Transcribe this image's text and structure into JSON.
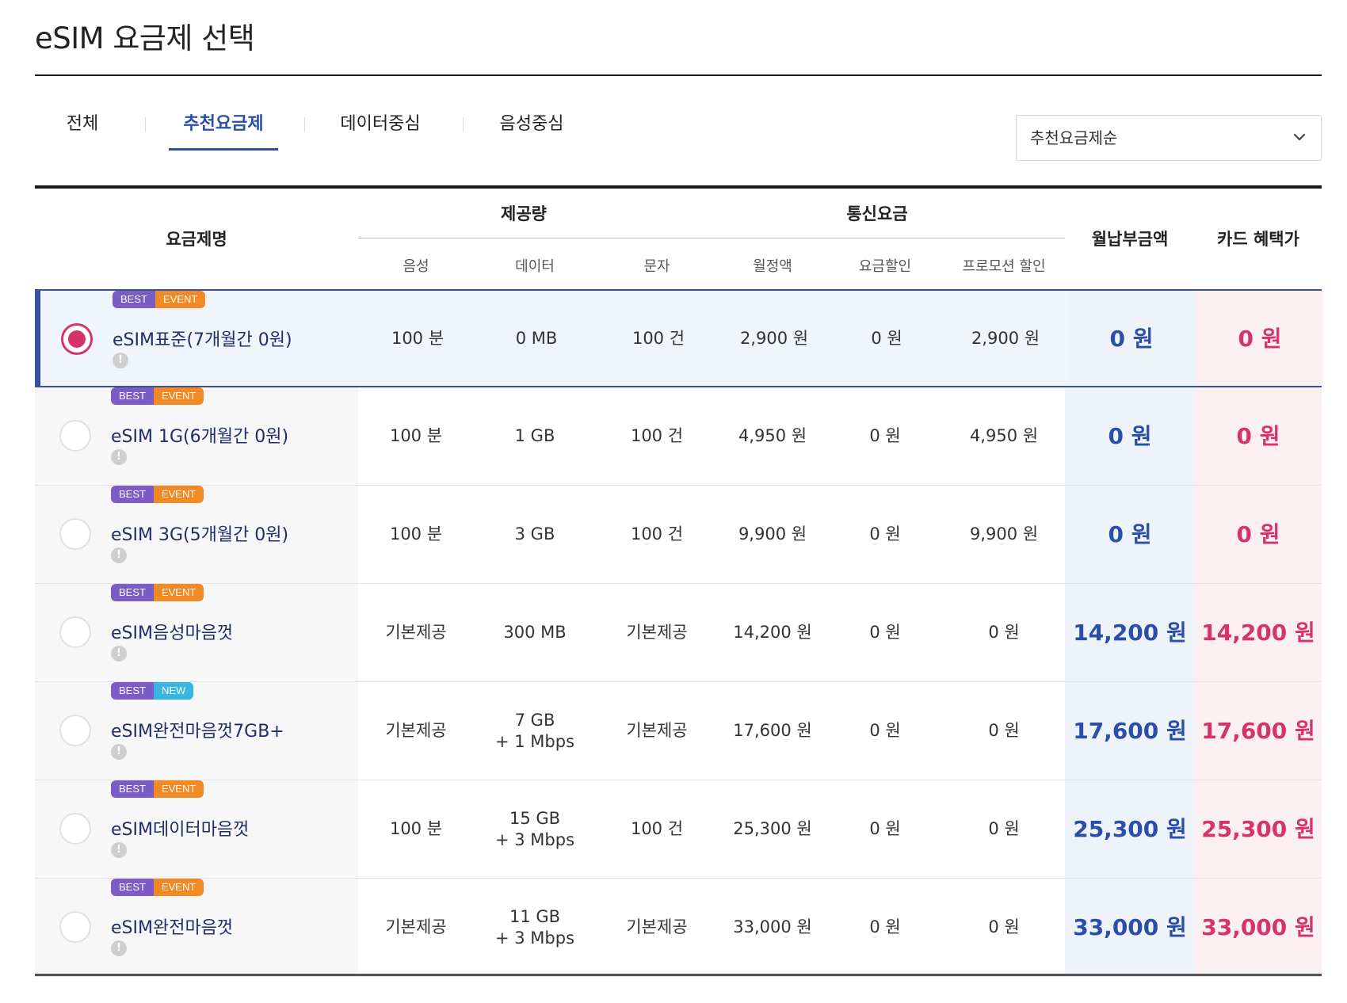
{
  "page": {
    "title": "eSIM 요금제 선택"
  },
  "tabs": [
    {
      "label": "전체",
      "active": false
    },
    {
      "label": "추천요금제",
      "active": true
    },
    {
      "label": "데이터중심",
      "active": false
    },
    {
      "label": "음성중심",
      "active": false
    }
  ],
  "sort": {
    "selected": "추천요금제순"
  },
  "table": {
    "headers": {
      "plan_name": "요금제명",
      "provided": "제공량",
      "fee": "통신요금",
      "monthly_pay": "월납부금액",
      "card_benefit": "카드 혜택가",
      "voice": "음성",
      "data": "데이터",
      "sms": "문자",
      "monthly_fee": "월정액",
      "fee_discount": "요금할인",
      "promo_discount": "프로모션 할인"
    },
    "rows": [
      {
        "badge1": "BEST",
        "badge2": "EVENT",
        "badge2_type": "event",
        "name": "eSIM표준(7개월간 0원)",
        "voice": "100 분",
        "data": "0 MB",
        "data_speed": "",
        "sms": "100 건",
        "monthly_fee": "2,900 원",
        "fee_discount": "0 원",
        "promo_discount": "2,900 원",
        "monthly_pay": "0 원",
        "card_benefit": "0 원",
        "selected": true
      },
      {
        "badge1": "BEST",
        "badge2": "EVENT",
        "badge2_type": "event",
        "name": "eSIM 1G(6개월간 0원)",
        "voice": "100 분",
        "data": "1 GB",
        "data_speed": "",
        "sms": "100 건",
        "monthly_fee": "4,950 원",
        "fee_discount": "0 원",
        "promo_discount": "4,950 원",
        "monthly_pay": "0 원",
        "card_benefit": "0 원",
        "selected": false
      },
      {
        "badge1": "BEST",
        "badge2": "EVENT",
        "badge2_type": "event",
        "name": "eSIM 3G(5개월간 0원)",
        "voice": "100 분",
        "data": "3 GB",
        "data_speed": "",
        "sms": "100 건",
        "monthly_fee": "9,900 원",
        "fee_discount": "0 원",
        "promo_discount": "9,900 원",
        "monthly_pay": "0 원",
        "card_benefit": "0 원",
        "selected": false
      },
      {
        "badge1": "BEST",
        "badge2": "EVENT",
        "badge2_type": "event",
        "name": "eSIM음성마음껏",
        "voice": "기본제공",
        "data": "300 MB",
        "data_speed": "",
        "sms": "기본제공",
        "monthly_fee": "14,200 원",
        "fee_discount": "0 원",
        "promo_discount": "0 원",
        "monthly_pay": "14,200 원",
        "card_benefit": "14,200 원",
        "selected": false
      },
      {
        "badge1": "BEST",
        "badge2": "NEW",
        "badge2_type": "new",
        "name": "eSIM완전마음껏7GB+",
        "voice": "기본제공",
        "data": "7 GB",
        "data_speed": "+ 1 Mbps",
        "sms": "기본제공",
        "monthly_fee": "17,600 원",
        "fee_discount": "0 원",
        "promo_discount": "0 원",
        "monthly_pay": "17,600 원",
        "card_benefit": "17,600 원",
        "selected": false
      },
      {
        "badge1": "BEST",
        "badge2": "EVENT",
        "badge2_type": "event",
        "name": "eSIM데이터마음껏",
        "voice": "100 분",
        "data": "15 GB",
        "data_speed": "+ 3 Mbps",
        "sms": "100 건",
        "monthly_fee": "25,300 원",
        "fee_discount": "0 원",
        "promo_discount": "0 원",
        "monthly_pay": "25,300 원",
        "card_benefit": "25,300 원",
        "selected": false
      },
      {
        "badge1": "BEST",
        "badge2": "EVENT",
        "badge2_type": "event",
        "name": "eSIM완전마음껏",
        "voice": "기본제공",
        "data": "11 GB",
        "data_speed": "+ 3 Mbps",
        "sms": "기본제공",
        "monthly_fee": "33,000 원",
        "fee_discount": "0 원",
        "promo_discount": "0 원",
        "monthly_pay": "33,000 원",
        "card_benefit": "33,000 원",
        "selected": false
      }
    ]
  },
  "colors": {
    "accent_blue": "#2b4fa8",
    "accent_pink": "#d6336c",
    "badge_best": "#7b5cc4",
    "badge_event": "#f08a24",
    "badge_new": "#38b6e0"
  },
  "icons": {
    "sort_chevron": "chevron-down-icon",
    "info": "info-icon"
  }
}
